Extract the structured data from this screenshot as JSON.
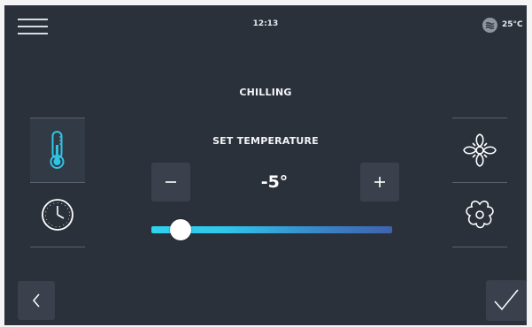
{
  "header": {
    "time": "12:13",
    "status_icon": "waves-icon",
    "status_temperature": "25°C",
    "menu_icon": "hamburger-menu-icon"
  },
  "main": {
    "mode_title": "CHILLING",
    "setting_label": "SET TEMPERATURE",
    "temperature_value": "-5°",
    "minus_icon": "minus-icon",
    "plus_icon": "plus-icon",
    "slider": {
      "level": 0.12
    }
  },
  "left_tabs": [
    {
      "icon": "thermometer-icon",
      "selected": true
    },
    {
      "icon": "clock-icon",
      "selected": false
    }
  ],
  "right_tabs": [
    {
      "icon": "fan-icon"
    },
    {
      "icon": "flower-icon"
    }
  ],
  "footer": {
    "back_icon": "chevron-left-icon",
    "confirm_icon": "checkmark-icon"
  },
  "colors": {
    "background": "#2b313b",
    "button": "#3a414c",
    "accent_cyan": "#2fd2ef",
    "accent_blue": "#3f63ad",
    "thermometer": "#2ec4e6"
  }
}
